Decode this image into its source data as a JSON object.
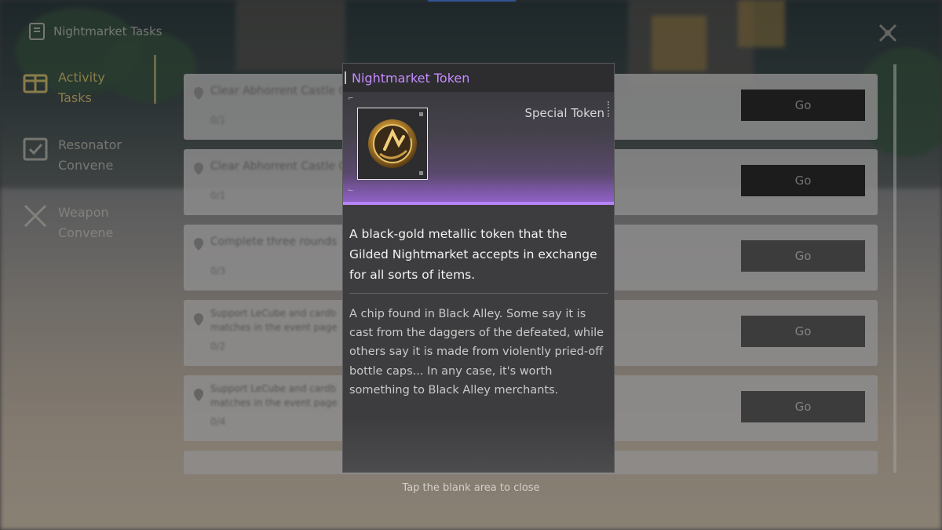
{
  "background_panel": {
    "title": "Nightmarket Tasks",
    "sidebar": [
      {
        "label": "Activity Tasks",
        "icon": "gift-icon",
        "active": true
      },
      {
        "label": "Resonator Convene",
        "icon": "checklist-icon",
        "active": false
      },
      {
        "label": "Weapon Convene",
        "icon": "crossed-swords-icon",
        "active": false
      }
    ],
    "tasks": [
      {
        "title": "Clear Abhorrent Castle G",
        "progress": "0/1",
        "button": "Go"
      },
      {
        "title": "Clear Abhorrent Castle G",
        "progress": "0/1",
        "button": "Go"
      },
      {
        "title": "Complete three rounds",
        "progress": "0/3",
        "button": "Go"
      },
      {
        "title": "Support LeCube and cardb matches in the event page",
        "progress": "0/2",
        "button": "Go"
      },
      {
        "title": "Support LeCube and cardb matches in the event page",
        "progress": "0/4",
        "button": "Go"
      }
    ]
  },
  "item_card": {
    "name": "Nightmarket Token",
    "type": "Special Token",
    "icon": "gold-token-icon",
    "description": "A black-gold metallic token that the Gilded Nightmarket accepts in exchange for all sorts of items.",
    "lore": "A chip found in Black Alley. Some say it is cast from the daggers of the defeated, while others say it is made from violently pried-off bottle caps... In any case, it's worth something to Black Alley merchants.",
    "accent_color": "#c58cff"
  },
  "close_hint": "Tap the blank area to close"
}
